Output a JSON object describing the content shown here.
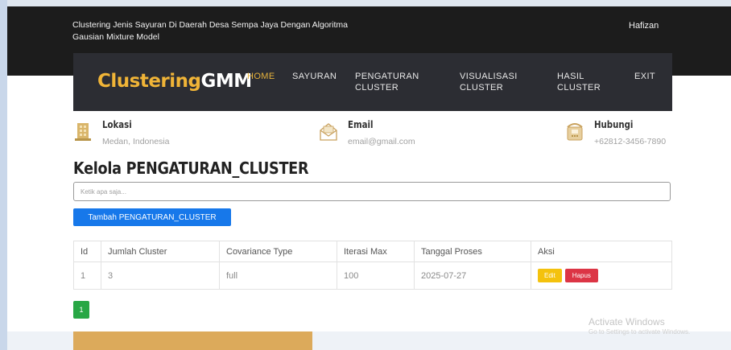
{
  "header": {
    "site_title": "Clustering Jenis Sayuran Di Daerah Desa Sempa Jaya Dengan Algoritma Gausian Mixture Model",
    "user": "Hafizan"
  },
  "brand": {
    "part1": "Clustering",
    "part2": "GMM"
  },
  "nav": [
    {
      "line1": "HOME",
      "line2": ""
    },
    {
      "line1": "SAYURAN",
      "line2": ""
    },
    {
      "line1": "PENGATURAN",
      "line2": "CLUSTER"
    },
    {
      "line1": "VISUALISASI",
      "line2": "CLUSTER"
    },
    {
      "line1": "HASIL",
      "line2": "CLUSTER"
    },
    {
      "line1": "EXIT",
      "line2": ""
    }
  ],
  "info": {
    "lokasi": {
      "title": "Lokasi",
      "value": "Medan, Indonesia",
      "icon": "building-icon"
    },
    "email": {
      "title": "Email",
      "value": "email@gmail.com",
      "icon": "envelope-icon"
    },
    "hubungi": {
      "title": "Hubungi",
      "value": "+62812-3456-7890",
      "icon": "phone-icon"
    }
  },
  "page": {
    "title": "Kelola PENGATURAN_CLUSTER",
    "search_placeholder": "Ketik apa saja...",
    "add_button": "Tambah PENGATURAN_CLUSTER"
  },
  "table": {
    "headers": [
      "Id",
      "Jumlah Cluster",
      "Covariance Type",
      "Iterasi Max",
      "Tanggal Proses",
      "Aksi"
    ],
    "rows": [
      {
        "id": "1",
        "jumlah_cluster": "3",
        "covariance_type": "full",
        "iterasi_max": "100",
        "tanggal_proses": "2025-07-27",
        "edit_label": "Edit",
        "delete_label": "Hapus"
      }
    ]
  },
  "pagination": {
    "current": "1"
  },
  "watermark": {
    "line1": "Activate Windows",
    "line2": "Go to Settings to activate Windows."
  },
  "colors": {
    "brand_accent": "#f0b437",
    "nav_bg": "#2c2d33",
    "topbar_bg": "#1c1c1c",
    "primary": "#1778ea",
    "success": "#28a745",
    "warning": "#f4c20d",
    "danger": "#dc3545"
  }
}
